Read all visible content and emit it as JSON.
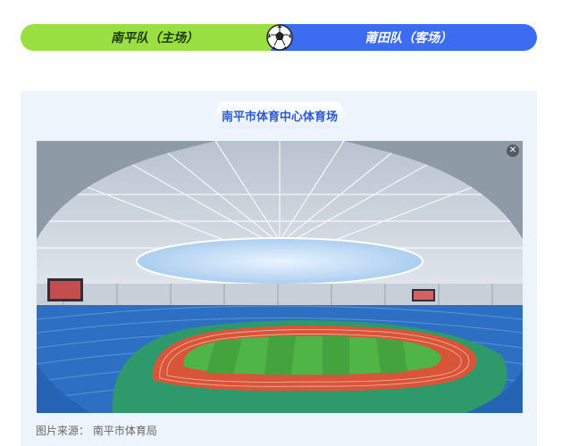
{
  "matchup": {
    "home_team": "南平队（主场）",
    "away_team": "莆田队（客场）",
    "home_color": "#9be043",
    "away_color": "#3b6cf2",
    "center_icon": "soccer-ball-icon"
  },
  "venue": {
    "title": "南平市体育中心体育场",
    "photo_subject": "stadium-interior-photo",
    "close_icon": "close-icon",
    "close_glyph": "✕",
    "caption": "图片来源：  南平市体育局"
  }
}
